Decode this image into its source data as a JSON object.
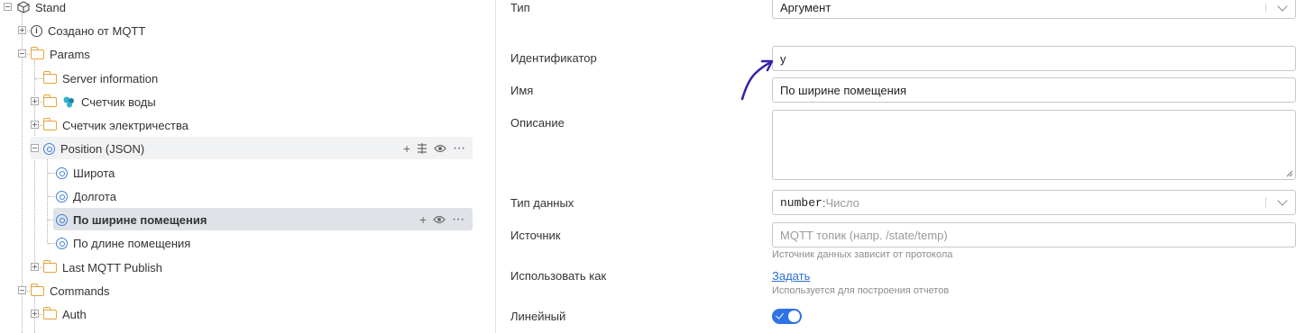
{
  "tree": {
    "nodes": [
      {
        "label": "Stand",
        "icon": "cube-icon"
      },
      {
        "label": "Создано от MQTT",
        "icon": "info-icon"
      },
      {
        "label": "Params",
        "icon": "folder-icon"
      },
      {
        "label": "Server information",
        "icon": "folder-icon"
      },
      {
        "label": "Счетчик воды",
        "icon": "folder-icon"
      },
      {
        "label": "Счетчик электричества",
        "icon": "folder-icon"
      },
      {
        "label": "Position (JSON)",
        "icon": "param-icon"
      },
      {
        "label": "Широта",
        "icon": "param-icon"
      },
      {
        "label": "Долгота",
        "icon": "param-icon"
      },
      {
        "label": "По ширине помещения",
        "icon": "param-icon"
      },
      {
        "label": "По длине помещения",
        "icon": "param-icon"
      },
      {
        "label": "Last MQTT Publish",
        "icon": "folder-icon"
      },
      {
        "label": "Commands",
        "icon": "folder-icon"
      },
      {
        "label": "Auth",
        "icon": "folder-icon"
      }
    ]
  },
  "form": {
    "type": {
      "label": "Тип",
      "value": "Аргумент"
    },
    "identifier": {
      "label": "Идентификатор",
      "value": "y"
    },
    "name": {
      "label": "Имя",
      "value": "По ширине помещения"
    },
    "description": {
      "label": "Описание",
      "value": ""
    },
    "data_type": {
      "label": "Тип данных",
      "code": "number",
      "sep": " : ",
      "text": "Число"
    },
    "source": {
      "label": "Источник",
      "placeholder": "MQTT топик (напр. /state/temp)",
      "hint": "Источник данных зависит от протокола"
    },
    "use_as": {
      "label": "Использовать как",
      "link": "Задать",
      "hint": "Используется для построения отчетов"
    },
    "linear": {
      "label": "Линейный",
      "enabled": true
    }
  },
  "colors": {
    "accent": "#2f72e4",
    "folder": "#e8a33a",
    "param": "#3c7fd8",
    "annotation": "#3a1fa8"
  }
}
